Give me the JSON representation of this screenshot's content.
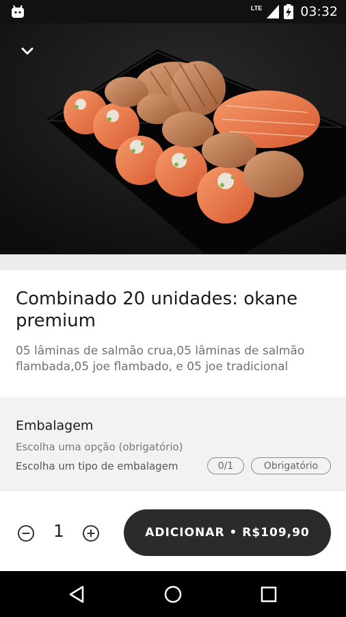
{
  "status_bar": {
    "network": "LTE",
    "time": "03:32",
    "icons": [
      "android-notification-icon",
      "lte-signal-icon",
      "battery-charging-icon"
    ]
  },
  "hero": {
    "collapse_icon": "chevron-down-icon"
  },
  "product": {
    "title": "Combinado 20 unidades: okane premium",
    "description": "05 lâminas de salmão crua,05 lâminas de salmão flambada,05 joe flambado, e 05 joe tradicional"
  },
  "option_group": {
    "title": "Embalagem",
    "subtitle": "Escolha uma opção (obrigatório)",
    "instruction": "Escolha um tipo de embalagem",
    "count_badge": "0/1",
    "required_badge": "Obrigatório"
  },
  "cart": {
    "quantity": "1",
    "minus_icon": "minus-circle-icon",
    "plus_icon": "plus-circle-icon",
    "add_button_label": "ADICIONAR • R$109,90"
  },
  "nav_bar": {
    "icons": [
      "back-triangle-icon",
      "home-circle-icon",
      "recents-square-icon"
    ]
  },
  "colors": {
    "hero_bg": "#141414",
    "button_bg": "#2b2b2b",
    "salmon": "#f07a4e",
    "group_bg": "#f2f2f2"
  }
}
